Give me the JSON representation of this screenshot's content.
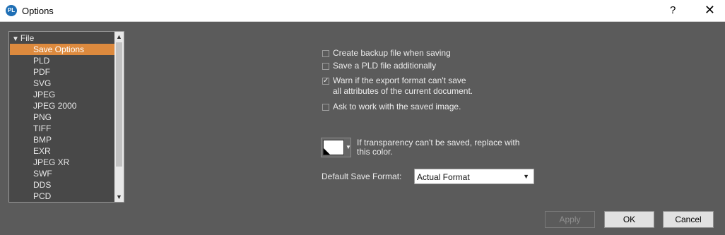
{
  "window": {
    "title": "Options",
    "app_icon_text": "PL",
    "help_glyph": "?",
    "close_glyph": "✕"
  },
  "tree": {
    "folder_label": "File",
    "expand_glyph": "▼",
    "items": [
      {
        "label": "Save Options",
        "selected": true
      },
      {
        "label": "PLD"
      },
      {
        "label": "PDF"
      },
      {
        "label": "SVG"
      },
      {
        "label": "JPEG"
      },
      {
        "label": "JPEG 2000"
      },
      {
        "label": "PNG"
      },
      {
        "label": "TIFF"
      },
      {
        "label": "BMP"
      },
      {
        "label": "EXR"
      },
      {
        "label": "JPEG XR"
      },
      {
        "label": "SWF"
      },
      {
        "label": "DDS"
      },
      {
        "label": "PCD"
      }
    ],
    "scroll_up_glyph": "▲",
    "scroll_down_glyph": "▼"
  },
  "options": {
    "backup": {
      "label": "Create backup file when saving",
      "checked": false
    },
    "pld_copy": {
      "label": "Save a PLD file additionally",
      "checked": false
    },
    "warn_export": {
      "line1": "Warn if the export format can't save",
      "line2": "all attributes of the current document.",
      "checked": true
    },
    "ask_work": {
      "label": "Ask to work with the saved image.",
      "checked": false
    },
    "check_glyph": "✓"
  },
  "transparency": {
    "label": "If transparency can't be saved, replace with this color.",
    "color": "#ffffff",
    "arrow_glyph": "▼"
  },
  "save_format": {
    "label": "Default Save Format:",
    "value": "Actual Format",
    "arrow_glyph": "▼"
  },
  "buttons": {
    "apply": "Apply",
    "ok": "OK",
    "cancel": "Cancel"
  },
  "colors": {
    "background": "#5b5b5b",
    "selection": "#dd8a3e",
    "tree_bg": "#484848"
  }
}
